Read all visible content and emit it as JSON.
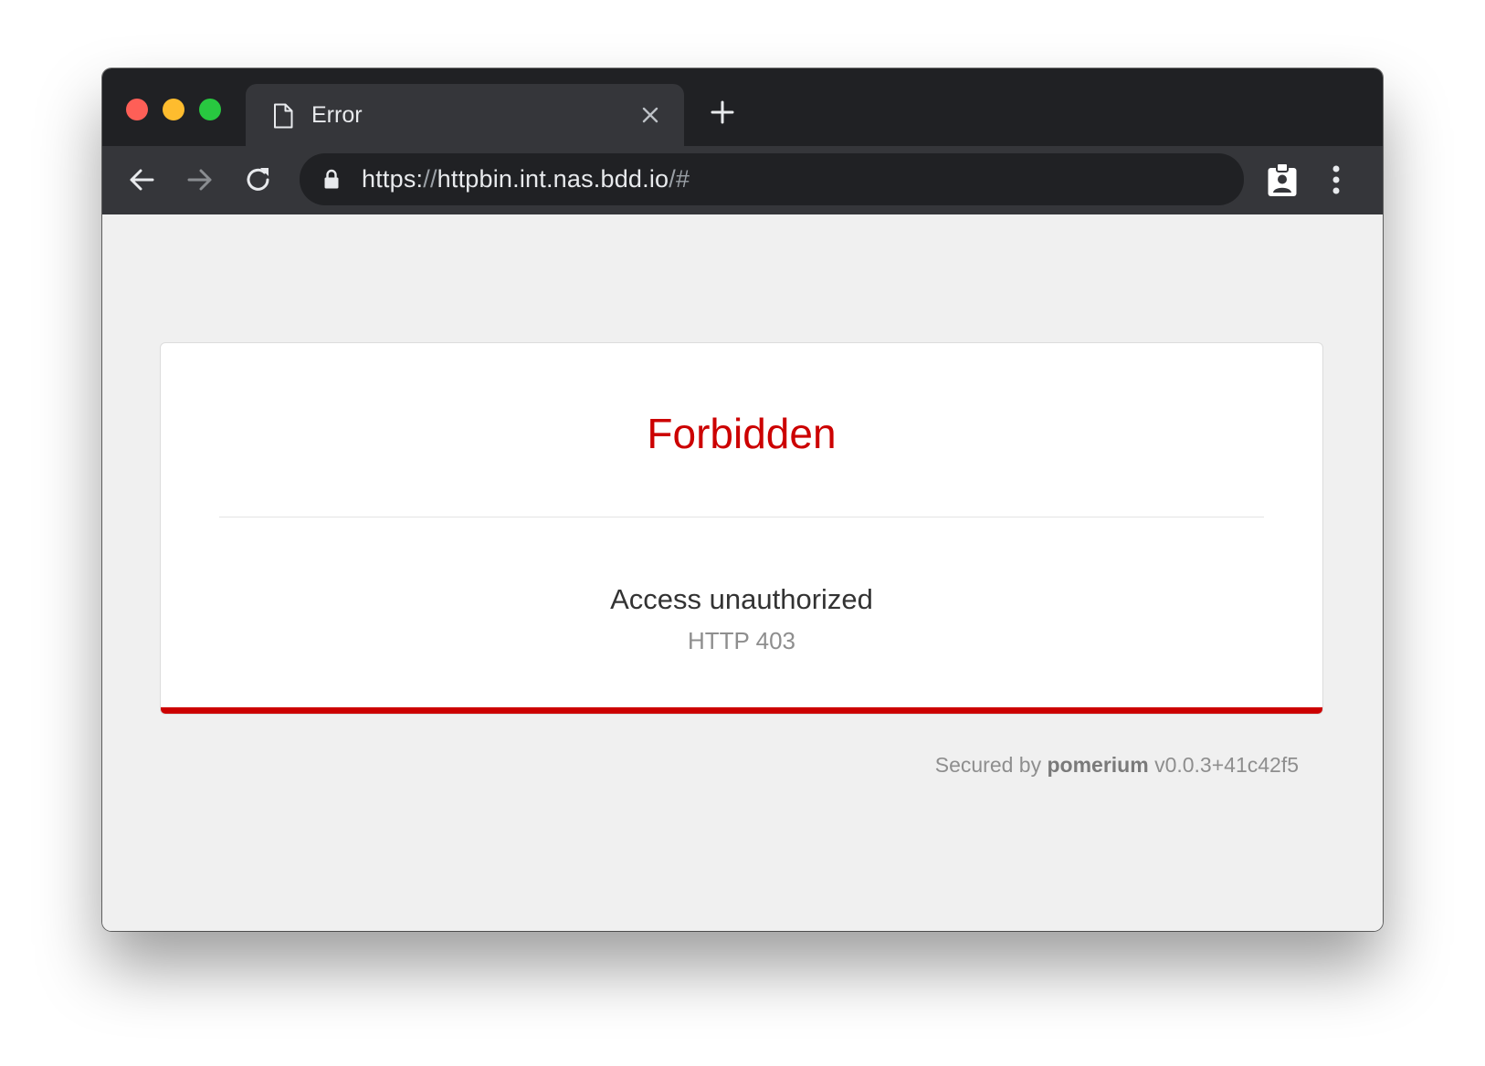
{
  "browser": {
    "tab": {
      "title": "Error",
      "icon": "document-icon",
      "close_icon": "close-icon"
    },
    "new_tab_icon": "plus-icon",
    "toolbar": {
      "back_icon": "arrow-left-icon",
      "forward_icon": "arrow-right-icon",
      "reload_icon": "reload-icon",
      "extension_icon": "clipboard-account-icon",
      "menu_icon": "vertical-dots-icon"
    },
    "address_bar": {
      "lock_icon": "lock-icon",
      "scheme": "https:",
      "separator": "//",
      "host": "httpbin.int.nas.bdd.io",
      "path": "/#"
    },
    "colors": {
      "titlebar": "#202124",
      "toolbar": "#35363a",
      "omnibox": "#202124",
      "close_button": "#fe5f57",
      "minimize_button": "#febc2e",
      "zoom_button": "#28c840"
    }
  },
  "page": {
    "title": "Forbidden",
    "message": "Access unauthorized",
    "status": "HTTP 403",
    "footer": {
      "prefix": "Secured by",
      "brand": "pomerium",
      "version": "v0.0.3+41c42f5"
    },
    "colors": {
      "accent": "#cc0000",
      "background": "#f0f0f0",
      "card": "#ffffff",
      "muted_text": "#8e8e8e"
    }
  }
}
